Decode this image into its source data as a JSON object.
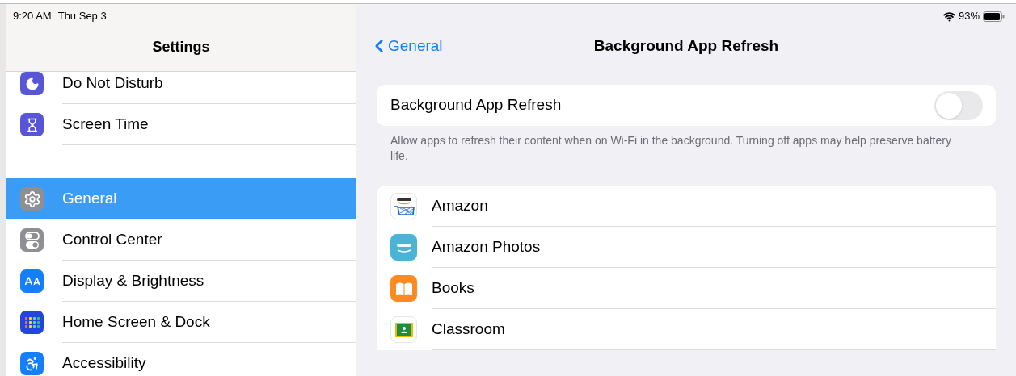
{
  "status_bar": {
    "time": "9:20 AM",
    "date": "Thu Sep 3",
    "battery": "93%"
  },
  "sidebar": {
    "title": "Settings",
    "groups": [
      [
        {
          "label": "Do Not Disturb",
          "kind": "moon",
          "selected": false
        },
        {
          "label": "Screen Time",
          "kind": "hourglass",
          "selected": false
        }
      ],
      [
        {
          "label": "General",
          "kind": "gear",
          "selected": true
        },
        {
          "label": "Control Center",
          "kind": "switches",
          "selected": false
        },
        {
          "label": "Display & Brightness",
          "kind": "text-size",
          "selected": false
        },
        {
          "label": "Home Screen & Dock",
          "kind": "grid",
          "selected": false
        },
        {
          "label": "Accessibility",
          "kind": "accessibility",
          "selected": false
        }
      ]
    ]
  },
  "detail": {
    "back": "General",
    "title": "Background App Refresh",
    "toggle": {
      "label": "Background App Refresh",
      "on": false
    },
    "footer": "Allow apps to refresh their content when on Wi-Fi in the background. Turning off apps may help preserve battery life.",
    "apps": [
      {
        "name": "Amazon",
        "kind": "cart"
      },
      {
        "name": "Amazon Photos",
        "kind": "photos"
      },
      {
        "name": "Books",
        "kind": "book"
      },
      {
        "name": "Classroom",
        "kind": "board"
      }
    ]
  }
}
